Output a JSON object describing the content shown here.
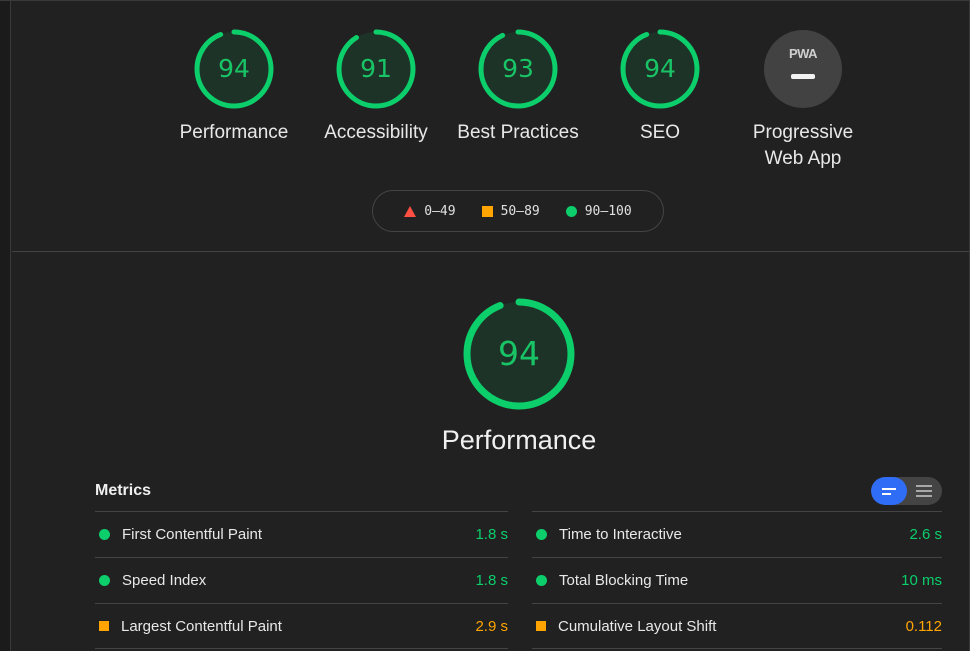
{
  "summary": {
    "gauges": [
      {
        "score": "94",
        "label": "Performance",
        "color": "#0cce6b"
      },
      {
        "score": "91",
        "label": "Accessibility",
        "color": "#0cce6b"
      },
      {
        "score": "93",
        "label": "Best Practices",
        "color": "#0cce6b"
      },
      {
        "score": "94",
        "label": "SEO",
        "color": "#0cce6b"
      }
    ],
    "pwa": {
      "badge_text": "PWA",
      "label_line1": "Progressive",
      "label_line2": "Web App"
    }
  },
  "legend": {
    "fail": "0–49",
    "average": "50–89",
    "pass": "90–100",
    "colors": {
      "fail": "#ff4e42",
      "average": "#ffa400",
      "pass": "#0cce6b"
    }
  },
  "performance": {
    "score": "94",
    "label": "Performance"
  },
  "metrics": {
    "title": "Metrics",
    "left": [
      {
        "name": "First Contentful Paint",
        "value": "1.8 s",
        "status": "pass"
      },
      {
        "name": "Speed Index",
        "value": "1.8 s",
        "status": "pass"
      },
      {
        "name": "Largest Contentful Paint",
        "value": "2.9 s",
        "status": "average"
      }
    ],
    "right": [
      {
        "name": "Time to Interactive",
        "value": "2.6 s",
        "status": "pass"
      },
      {
        "name": "Total Blocking Time",
        "value": "10 ms",
        "status": "pass"
      },
      {
        "name": "Cumulative Layout Shift",
        "value": "0.112",
        "status": "average"
      }
    ]
  }
}
